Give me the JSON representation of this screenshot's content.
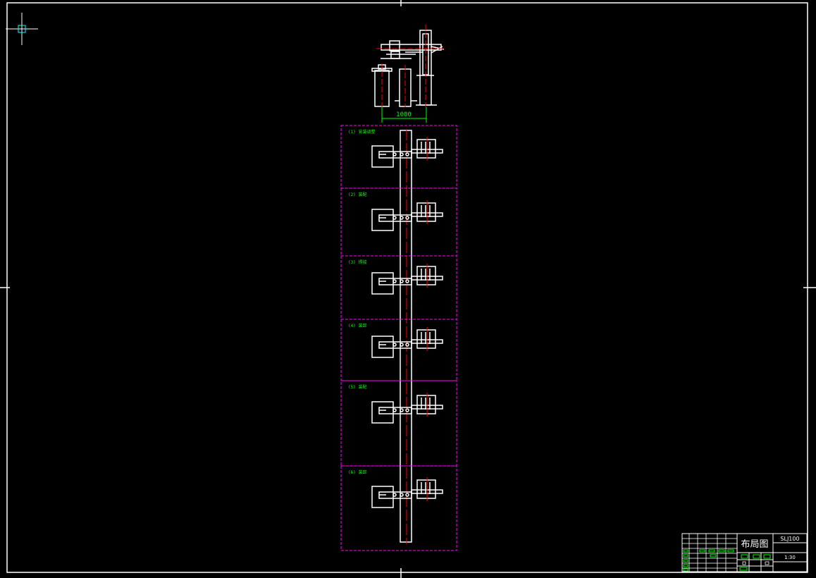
{
  "drawing": {
    "dimension_label": "1000",
    "title_block": {
      "title": "布局图",
      "code": "SLJ100",
      "scale_note": "1:30"
    },
    "stations": [
      {
        "label": "(1) 安装调整"
      },
      {
        "label": "(2) 装配"
      },
      {
        "label": "(3) 焊接"
      },
      {
        "label": "(4) 装卸"
      },
      {
        "label": "(5) 装配"
      },
      {
        "label": "(6) 装卸"
      }
    ]
  },
  "colors": {
    "background": "#000000",
    "line": "#ffffff",
    "centerline": "#ff0000",
    "dashed_frame": "#ff00ff",
    "annotation": "#00ff00",
    "cursor": "#00ffff"
  }
}
